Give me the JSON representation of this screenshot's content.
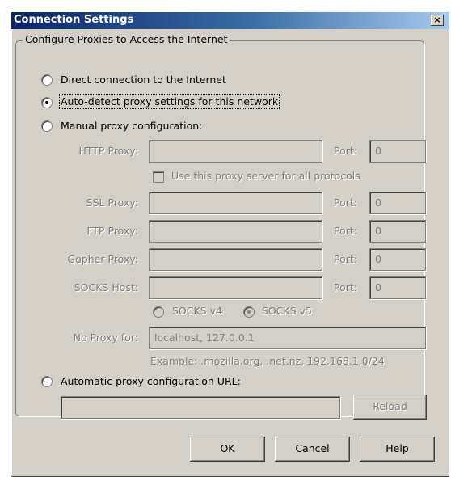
{
  "window": {
    "title": "Connection Settings",
    "close_glyph": "×"
  },
  "group_title": "Configure Proxies to Access the Internet",
  "radios": {
    "direct": {
      "label": "Direct connection to the Internet",
      "selected": false
    },
    "auto_detect": {
      "label": "Auto-detect proxy settings for this network",
      "selected": true
    },
    "manual": {
      "label": "Manual proxy configuration:",
      "selected": false
    },
    "auto_url": {
      "label": "Automatic proxy configuration URL:",
      "selected": false
    }
  },
  "manual": {
    "http": {
      "label": "HTTP Proxy:",
      "host": "",
      "port_label": "Port:",
      "port": "0"
    },
    "same_for_all": {
      "label": "Use this proxy server for all protocols",
      "checked": false
    },
    "ssl": {
      "label": "SSL Proxy:",
      "host": "",
      "port_label": "Port:",
      "port": "0"
    },
    "ftp": {
      "label": "FTP Proxy:",
      "host": "",
      "port_label": "Port:",
      "port": "0"
    },
    "gopher": {
      "label": "Gopher Proxy:",
      "host": "",
      "port_label": "Port:",
      "port": "0"
    },
    "socks": {
      "label": "SOCKS Host:",
      "host": "",
      "port_label": "Port:",
      "port": "0"
    },
    "socks_v4": {
      "label": "SOCKS v4",
      "selected": false
    },
    "socks_v5": {
      "label": "SOCKS v5",
      "selected": true
    },
    "no_proxy": {
      "label": "No Proxy for:",
      "value": "localhost, 127.0.0.1"
    },
    "example": "Example: .mozilla.org, .net.nz, 192.168.1.0/24"
  },
  "auto_url": {
    "value": "",
    "reload_label": "Reload"
  },
  "buttons": {
    "ok": "OK",
    "cancel": "Cancel",
    "help": "Help"
  },
  "icons": {
    "close": "close-icon",
    "radio": "radio-button",
    "checkbox": "checkbox"
  },
  "colors": {
    "dialog_bg": "#d4d0c8",
    "title_start": "#0a246a",
    "title_end": "#a6caf0",
    "disabled_text": "#808080"
  }
}
